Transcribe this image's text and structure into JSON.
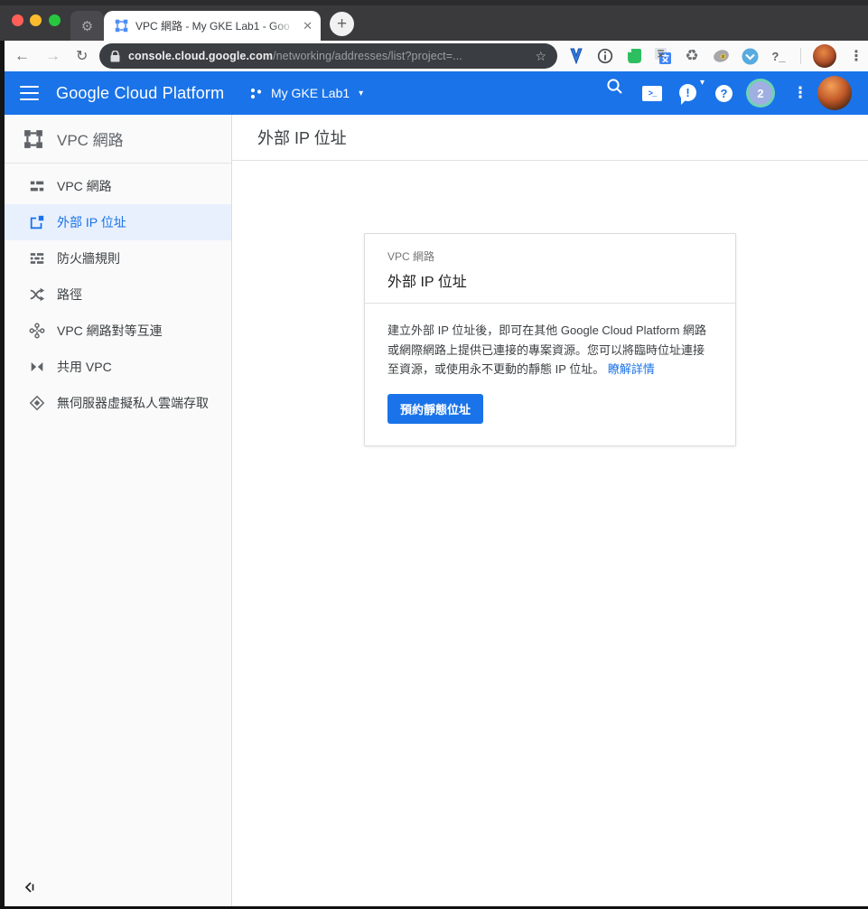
{
  "browser": {
    "tab_title": "VPC 網路 - My GKE Lab1 - Goo",
    "url": {
      "domain": "console.cloud.google.com",
      "path": "/networking/addresses/list?project=..."
    },
    "extensions": [
      "map-pin",
      "info-circle",
      "evernote",
      "translate",
      "recycle",
      "stamp",
      "pocket-check",
      "terminal"
    ]
  },
  "glyphs": {
    "back": "←",
    "forward": "→",
    "reload": "↻",
    "star": "☆",
    "plus": "+",
    "close": "✕",
    "gear": "⚙",
    "menu_dots": "⋮",
    "caret_down": "▾",
    "question": "?",
    "exclaim": "!",
    "shell_prompt": ">_",
    "terminal_ext": "?_",
    "recycle": "♻"
  },
  "header": {
    "product": "Google Cloud Platform",
    "project_name": "My GKE Lab1",
    "account_badge": "2"
  },
  "sidebar": {
    "title": "VPC 網路",
    "items": [
      {
        "label": "VPC 網路"
      },
      {
        "label": "外部 IP 位址"
      },
      {
        "label": "防火牆規則"
      },
      {
        "label": "路徑"
      },
      {
        "label": "VPC 網路對等互連"
      },
      {
        "label": "共用 VPC"
      },
      {
        "label": "無伺服器虛擬私人雲端存取"
      }
    ]
  },
  "main": {
    "page_title": "外部 IP 位址",
    "card": {
      "eyebrow": "VPC 網路",
      "title": "外部 IP 位址",
      "body": "建立外部 IP 位址後，即可在其他 Google Cloud Platform 網路或網際網路上提供已連接的專案資源。您可以將臨時位址連接至資源，或使用永不更動的靜態 IP 位址。",
      "link_label": "瞭解詳情",
      "button_label": "預約靜態位址"
    }
  },
  "colors": {
    "accent_blue": "#1a73e8",
    "selected_item_bg": "#e8f0fe",
    "tabstrip_bg": "#3a3a3d",
    "omnibox_bg": "#3a3d41",
    "badge_ring": "#6fd2b4",
    "badge_fill": "#9fafe2"
  }
}
